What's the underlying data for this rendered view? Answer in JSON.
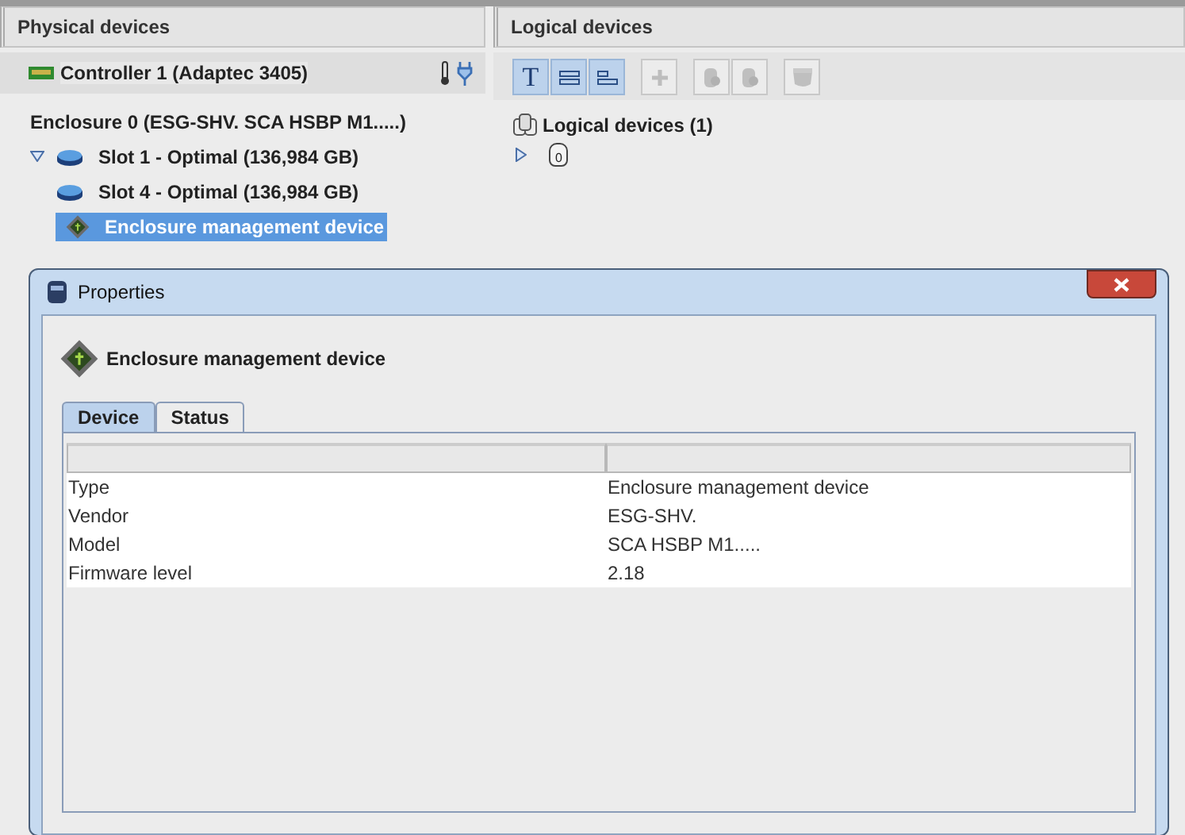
{
  "physical": {
    "title": "Physical devices",
    "controller": "Controller 1 (Adaptec 3405)",
    "tree": [
      {
        "label": "Enclosure 0 (ESG-SHV. SCA HSBP M1.....)",
        "children": [
          {
            "label": "Slot 1 - Optimal (136,984 GB)",
            "kind": "disk",
            "selected": false,
            "expanded": true
          },
          {
            "label": "Slot 4 - Optimal (136,984 GB)",
            "kind": "disk",
            "selected": false
          },
          {
            "label": "Enclosure management device",
            "kind": "chip",
            "selected": true
          }
        ]
      }
    ]
  },
  "logical": {
    "title": "Logical devices",
    "toolbar": [
      {
        "kind": "text",
        "label": "T",
        "selected": true,
        "disabled": false
      },
      {
        "kind": "rows",
        "selected": true,
        "disabled": false
      },
      {
        "kind": "rows-left",
        "selected": true,
        "disabled": false
      },
      {
        "kind": "add",
        "selected": false,
        "disabled": true
      },
      {
        "kind": "disk-add",
        "selected": false,
        "disabled": true
      },
      {
        "kind": "disk-remove",
        "selected": false,
        "disabled": true
      },
      {
        "kind": "cache",
        "selected": false,
        "disabled": true
      }
    ],
    "header": "Logical devices (1)",
    "devices": [
      {
        "label": "0",
        "expanded": false
      }
    ]
  },
  "dialog": {
    "title": "Properties",
    "heading": "Enclosure management device",
    "tabs": [
      {
        "label": "Device",
        "selected": true
      },
      {
        "label": "Status",
        "selected": false
      }
    ],
    "rows": [
      [
        "Type",
        "Enclosure management device"
      ],
      [
        "Vendor",
        "ESG-SHV."
      ],
      [
        "Model",
        "SCA HSBP M1....."
      ],
      [
        "Firmware level",
        "2.18"
      ]
    ]
  }
}
